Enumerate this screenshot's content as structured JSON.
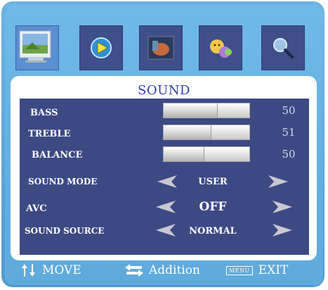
{
  "title": "SOUND",
  "tabs": [
    {
      "icon": "picture-icon",
      "active": true
    },
    {
      "icon": "play-icon",
      "active": false
    },
    {
      "icon": "image-icon",
      "active": false
    },
    {
      "icon": "settings-faces-icon",
      "active": false
    },
    {
      "icon": "magnifier-icon",
      "active": false
    }
  ],
  "sliders": [
    {
      "label": "BASS",
      "value": "50",
      "level": 0.62
    },
    {
      "label": "TREBLE",
      "value": "51",
      "level": 0.55
    },
    {
      "label": "BALANCE",
      "value": "50",
      "level": 0.47
    }
  ],
  "options": [
    {
      "label": "SOUND MODE",
      "value": "USER"
    },
    {
      "label": "AVC",
      "value": "OFF"
    },
    {
      "label": "SOUND SOURCE",
      "value": "NORMAL"
    }
  ],
  "help": {
    "move": "MOVE",
    "addition": "Addition",
    "menu_key": "MENU",
    "exit": "EXIT"
  },
  "colors": {
    "frame": "#5aa7db",
    "content": "#3c4a84",
    "title": "#2f43a8"
  }
}
